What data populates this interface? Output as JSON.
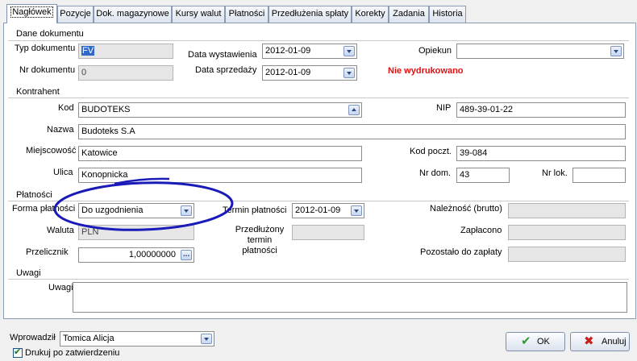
{
  "tabs": [
    {
      "label": "Nagłówek"
    },
    {
      "label": "Pozycje"
    },
    {
      "label": "Dok. magazynowe"
    },
    {
      "label": "Kursy walut"
    },
    {
      "label": "Płatności"
    },
    {
      "label": "Przedłużenia spłaty"
    },
    {
      "label": "Korekty"
    },
    {
      "label": "Zadania"
    },
    {
      "label": "Historia"
    }
  ],
  "document": {
    "group_title": "Dane dokumentu",
    "type_label": "Typ dokumentu",
    "type_value": "FV",
    "number_label": "Nr dokumentu",
    "number_value": "0",
    "issue_date_label": "Data wystawienia",
    "issue_date_value": "2012-01-09",
    "sale_date_label": "Data sprzedaży",
    "sale_date_value": "2012-01-09",
    "guardian_label": "Opiekun",
    "guardian_value": "",
    "print_status": "Nie wydrukowano"
  },
  "contractor": {
    "group_title": "Kontrahent",
    "code_label": "Kod",
    "code_value": "BUDOTEKS",
    "nip_label": "NIP",
    "nip_value": "489-39-01-22",
    "name_label": "Nazwa",
    "name_value": "Budoteks S.A",
    "city_label": "Miejscowość",
    "city_value": "Katowice",
    "postal_label": "Kod poczt.",
    "postal_value": "39-084",
    "street_label": "Ulica",
    "street_value": "Konopnicka",
    "house_label": "Nr dom.",
    "house_value": "43",
    "flat_label": "Nr lok.",
    "flat_value": ""
  },
  "payments": {
    "group_title": "Płatności",
    "method_label": "Forma płatności",
    "method_value": "Do uzgodnienia",
    "currency_label": "Waluta",
    "currency_value": "PLN",
    "rate_label": "Przelicznik",
    "rate_value": "1,00000000",
    "due_label": "Termin płatności",
    "due_value": "2012-01-09",
    "extended_label_1": "Przedłużony",
    "extended_label_2": "termin",
    "extended_label_3": "płatności",
    "extended_value": "",
    "gross_label": "Należność (brutto)",
    "gross_value": "",
    "paid_label": "Zapłacono",
    "paid_value": "",
    "remaining_label": "Pozostało do zapłaty",
    "remaining_value": ""
  },
  "notes": {
    "group_title": "Uwagi",
    "label": "Uwagi",
    "value": ""
  },
  "footer": {
    "entered_by_label": "Wprowadził",
    "entered_by_value": "Tomica Alicja",
    "print_checkbox_label": "Drukuj po zatwierdzeniu",
    "print_checkbox_checked": true,
    "ok_label": "OK",
    "cancel_label": "Anuluj"
  },
  "colors": {
    "warning": "#e01010",
    "annotation_ellipse": "#1a1ab8",
    "tab_border": "#8a9bb5"
  },
  "icons": {
    "ok": "check-icon",
    "cancel": "cross-icon",
    "dropdown": "chevron-down-icon"
  }
}
